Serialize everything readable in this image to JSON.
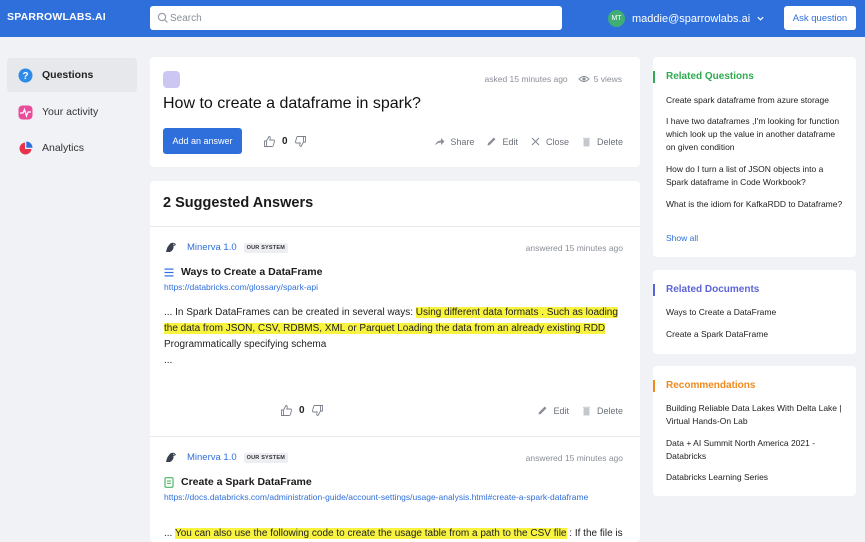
{
  "header": {
    "brand": "SPARROWLABS.AI",
    "search_placeholder": "Search",
    "user_initials": "MT",
    "user_email": "maddie@sparrowlabs.ai",
    "ask_button": "Ask question",
    "accent_color": "#2f6fdc"
  },
  "sidebar": {
    "items": [
      {
        "label": "Questions",
        "icon": "question-circle-icon",
        "active": true
      },
      {
        "label": "Your activity",
        "icon": "activity-pulse-icon",
        "active": false
      },
      {
        "label": "Analytics",
        "icon": "pie-chart-icon",
        "active": false
      }
    ]
  },
  "question": {
    "asked": "asked 15 minutes ago",
    "views": "5 views",
    "title": "How to create a dataframe in spark?",
    "add_answer": "Add an answer",
    "vote_count": "0",
    "actions": {
      "share": "Share",
      "edit": "Edit",
      "close": "Close",
      "delete": "Delete"
    }
  },
  "answers_section": {
    "title": "2 Suggested Answers",
    "answers": [
      {
        "author": "Minerva 1.0",
        "badge": "OUR SYSTEM",
        "answered": "answered 15 minutes ago",
        "source_title": "Ways to Create a DataFrame",
        "source_icon": "list-icon",
        "source_url": "https://databricks.com/glossary/spark-api",
        "snippet_plain": "... In Spark DataFrames can be created in several ways: ",
        "snippet_highlight": "Using different data formats . Such as loading the data from JSON, CSV, RDBMS, XML or Parquet Loading the data from an already existing RDD",
        "snippet_rest": " Programmatically specifying schema",
        "snippet_ellipsis": "...",
        "vote_count": "0",
        "actions": {
          "edit": "Edit",
          "delete": "Delete"
        }
      },
      {
        "author": "Minerva 1.0",
        "badge": "OUR SYSTEM",
        "answered": "answered 15 minutes ago",
        "source_title": "Create a Spark DataFrame",
        "source_icon": "document-icon",
        "source_url": "https://docs.databricks.com/administration-guide/account-settings/usage-analysis.html#create-a-spark-dataframe",
        "snippet_plain": "... ",
        "snippet_highlight": "You can also use the following code to create the usage table from a path to the CSV file",
        "snippet_rest": " : If the file is"
      }
    ]
  },
  "related_questions": {
    "title": "Related Questions",
    "color": "#2eaa4f",
    "items": [
      "Create spark dataframe from azure storage",
      "I have two dataframes ,I'm looking for function which look up the value in another dataframe on given condition",
      "How do I turn a list of JSON objects into a Spark dataframe in Code Workbook?",
      "What is the idiom for KafkaRDD to Dataframe?"
    ],
    "show_all": "Show all"
  },
  "related_documents": {
    "title": "Related Documents",
    "color": "#5b63d8",
    "items": [
      "Ways to Create a DataFrame",
      "Create a Spark DataFrame"
    ]
  },
  "recommendations": {
    "title": "Recommendations",
    "color": "#f08a1c",
    "items": [
      "Building Reliable Data Lakes With Delta Lake | Virtual Hands-On Lab",
      "Data + AI Summit North America 2021 - Databricks",
      "Databricks Learning Series"
    ]
  }
}
